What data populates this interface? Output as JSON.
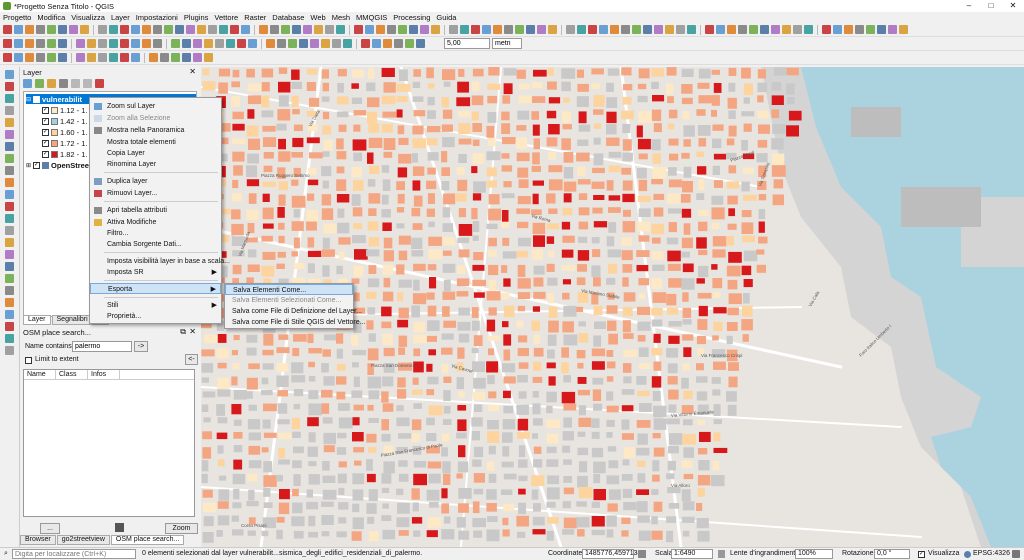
{
  "window": {
    "title": "*Progetto Senza Titolo - QGIS",
    "minimize": "–",
    "maximize": "□",
    "close": "✕"
  },
  "menu": [
    "Progetto",
    "Modifica",
    "Visualizza",
    "Layer",
    "Impostazioni",
    "Plugins",
    "Vettore",
    "Raster",
    "Database",
    "Web",
    "Mesh",
    "MMQGIS",
    "Processing",
    "Guida"
  ],
  "toolbar": {
    "scale_value": "5,00",
    "unit_value": "metri"
  },
  "layers_panel": {
    "title": "Layer",
    "layers": [
      {
        "name": "vulnerabilit",
        "checked": true,
        "selected": true
      },
      {
        "name": "1.12 - 1.",
        "color": "#fde9c6"
      },
      {
        "name": "1.42 - 1.",
        "color": "#a6cee3"
      },
      {
        "name": "1.60 - 1.",
        "color": "#fdd49e"
      },
      {
        "name": "1.72 - 1.",
        "color": "#f4a582"
      },
      {
        "name": "1.82 - 1.",
        "color": "#d7191c"
      },
      {
        "name": "OpenStreet",
        "checked": true
      }
    ],
    "tabs": [
      "Layer",
      "Segnalibri spaz"
    ]
  },
  "osm_panel": {
    "title": "OSM place search...",
    "name_label": "Name contains...",
    "name_value": "palermo",
    "go_button": "->",
    "limit_label": "Limit to extent",
    "back_button": "<-",
    "columns": [
      "Name",
      "Class",
      "Infos"
    ],
    "dots_button": "...",
    "zoom_button": "Zoom"
  },
  "bottom_tabs": [
    "Browser",
    "go2streetview",
    "OSM place search..."
  ],
  "context_menu": {
    "items": [
      {
        "label": "Zoom sul Layer",
        "disabled": false
      },
      {
        "label": "Zoom alla Selezione",
        "disabled": true
      },
      {
        "label": "Mostra nella Panoramica",
        "disabled": false
      },
      {
        "label": "Mostra totale elementi",
        "disabled": false
      },
      {
        "label": "Copia Layer",
        "disabled": false
      },
      {
        "label": "Rinomina Layer",
        "disabled": false
      },
      {
        "label": "Duplica layer",
        "disabled": false
      },
      {
        "label": "Rimuovi Layer...",
        "disabled": false
      },
      {
        "label": "Apri tabella attributi",
        "disabled": false
      },
      {
        "label": "Attiva Modifiche",
        "disabled": false
      },
      {
        "label": "Filtro...",
        "disabled": false
      },
      {
        "label": "Cambia Sorgente Dati...",
        "disabled": false
      },
      {
        "label": "Imposta visibilità layer in base a scala...",
        "disabled": false
      },
      {
        "label": "Imposta SR",
        "disabled": false,
        "submenu": true
      },
      {
        "label": "Esporta",
        "disabled": false,
        "submenu": true,
        "highlight": true
      },
      {
        "label": "Stili",
        "disabled": false,
        "submenu": true
      },
      {
        "label": "Proprietà...",
        "disabled": false
      }
    ],
    "arrow": "▶"
  },
  "export_submenu": {
    "items": [
      {
        "label": "Salva Elementi Come...",
        "highlight": true
      },
      {
        "label": "Salva Elementi Selezionati Come...",
        "disabled": true
      },
      {
        "label": "Salva come File di Definizione del Layer..."
      },
      {
        "label": "Salva come File di Stile QGIS del Vettore..."
      }
    ]
  },
  "map": {
    "streets": [
      "Via Daita",
      "Via Roma",
      "Via Mariano Stabile",
      "Via Cavour",
      "Via Vittorio Emanuele",
      "Piazza San Domenico",
      "Via Maqueda",
      "Piazza Verdi",
      "Via Sampolo",
      "Via Francesco Crispi",
      "Piazza San Francesco di Paola",
      "Corso Pisani",
      "Via Cala",
      "Foro Italico Umberto I",
      "Via Alloro",
      "Piazza Ruggero Settimo"
    ]
  },
  "status": {
    "search_placeholder": "Digita per localizzare (Ctrl+K)",
    "message": "0 elementi selezionati dal layer vulnerabilit...sismica_degli_edifici_residenziali_di_palermo.",
    "coord_label": "Coordinate",
    "coord_value": "1485776,4597138",
    "scale_label": "Scala",
    "scale_value": "1:6490",
    "lens_label": "Lente d'ingrandimento",
    "lens_value": "100%",
    "rotation_label": "Rotazione",
    "rotation_value": "0,0 °",
    "render_label": "Visualizza",
    "crs_value": "EPSG:4326"
  }
}
